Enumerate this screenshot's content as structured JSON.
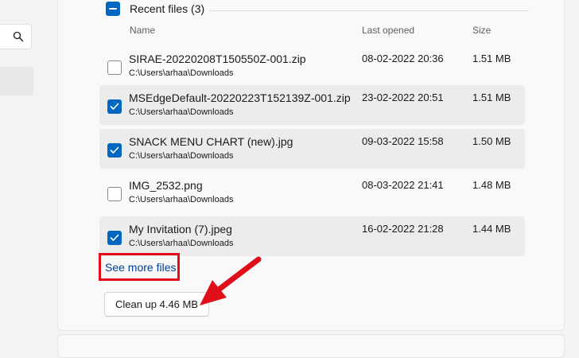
{
  "group": {
    "title": "Recent files (3)"
  },
  "columns": {
    "name": "Name",
    "last_opened": "Last opened",
    "size": "Size"
  },
  "files": [
    {
      "name": "SIRAE-20220208T150550Z-001.zip",
      "path": "C:\\Users\\arhaa\\Downloads",
      "last_opened": "08-02-2022 20:36",
      "size": "1.51 MB",
      "checked": false
    },
    {
      "name": "MSEdgeDefault-20220223T152139Z-001.zip",
      "path": "C:\\Users\\arhaa\\Downloads",
      "last_opened": "23-02-2022 20:51",
      "size": "1.51 MB",
      "checked": true
    },
    {
      "name": "SNACK MENU CHART (new).jpg",
      "path": "C:\\Users\\arhaa\\Downloads",
      "last_opened": "09-03-2022 15:58",
      "size": "1.50 MB",
      "checked": true
    },
    {
      "name": "IMG_2532.png",
      "path": "C:\\Users\\arhaa\\Downloads",
      "last_opened": "08-03-2022 21:41",
      "size": "1.48 MB",
      "checked": false
    },
    {
      "name": "My Invitation (7).jpeg",
      "path": "C:\\Users\\arhaa\\Downloads",
      "last_opened": "16-02-2022 21:28",
      "size": "1.44 MB",
      "checked": true
    }
  ],
  "see_more_label": "See more files",
  "cleanup_label": "Clean up 4.46 MB",
  "colors": {
    "accent": "#0067c0",
    "link": "#003e92",
    "highlight": "#e0101a"
  },
  "icons": {
    "search": "search-icon",
    "checkbox_checked": "checkmark-icon",
    "group_indeterminate": "minus-icon",
    "annotation": "red-arrow-icon"
  }
}
